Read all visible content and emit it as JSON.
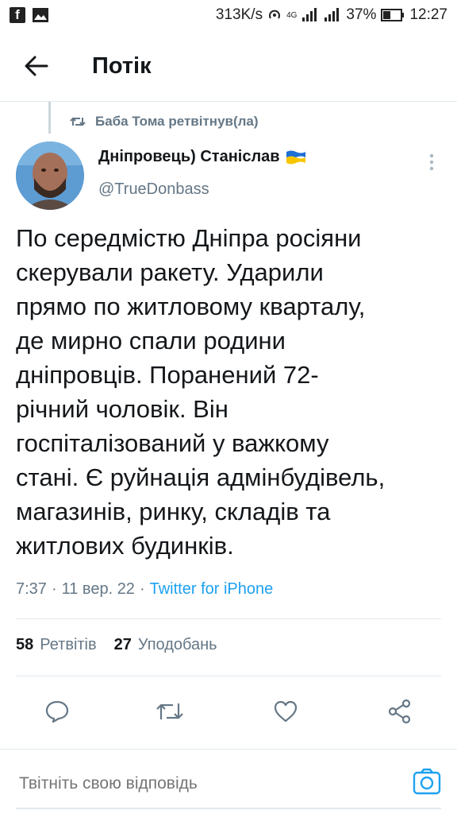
{
  "status_bar": {
    "network_speed": "313K/s",
    "network_type": "4G",
    "battery": "37%",
    "time": "12:27"
  },
  "header": {
    "title": "Потік"
  },
  "retweet": {
    "text": "Баба Тома ретвітнув(ла)"
  },
  "tweet": {
    "author_name": "Дніпровець) Станіслав",
    "handle": "@TrueDonbass",
    "text": "По середмістю Дніпра  росіяни\nскерували ракету. Ударили\nпрямо по житловому кварталу,\nде мирно спали родини\nдніпровців. Поранений 72-\nрічний чоловік. Він\nгоспіталізований у важкому\nстані. Є руйнація адмінбудівель,\nмагазинів, ринку, складів та\nжитлових будинків.",
    "time": "7:37",
    "date": "11 вер. 22",
    "source": "Twitter for iPhone",
    "separator": "·"
  },
  "stats": {
    "retweets_count": "58",
    "retweets_label": "Ретвітів",
    "likes_count": "27",
    "likes_label": "Уподобань"
  },
  "reply": {
    "placeholder": "Твітніть свою відповідь"
  },
  "colors": {
    "accent": "#1da1f2",
    "secondary_text": "#657786",
    "divider": "#e1e8ed"
  }
}
